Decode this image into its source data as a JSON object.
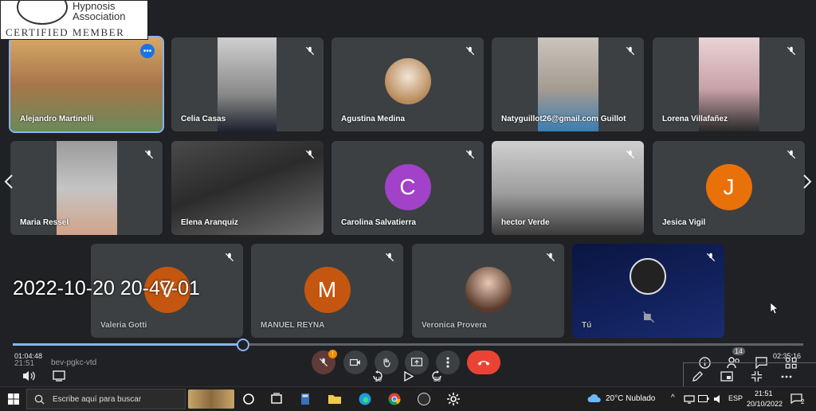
{
  "logo": {
    "assoc_text": "Hypnosis\nAssociation",
    "cert_text": "CERTIFIED MEMBER"
  },
  "participants": {
    "row1": [
      {
        "name": "Alejandro Martinelli"
      },
      {
        "name": "Celia Casas"
      },
      {
        "name": "Agustina Medina"
      },
      {
        "name": "Natyguillot26@gmail.com Guillot"
      },
      {
        "name": "Lorena Villafañez"
      }
    ],
    "row2": [
      {
        "name": "Maria Ressel"
      },
      {
        "name": "Elena Aranquiz"
      },
      {
        "name": "Carolina Salvatierra",
        "initial": "C",
        "color": "#a142c8"
      },
      {
        "name": "hector Verde"
      },
      {
        "name": "Jesica Vigil",
        "initial": "J",
        "color": "#e8710a"
      }
    ],
    "row3": [
      {
        "name": "Valeria Gotti",
        "initial": "V",
        "color": "#c5560f"
      },
      {
        "name": "MANUEL REYNA",
        "initial": "M",
        "color": "#c5560f"
      },
      {
        "name": "Veronica Provera"
      },
      {
        "name": "Tú"
      }
    ]
  },
  "recording": {
    "timestamp": "2022-10-20 20-47-01",
    "elapsed": "01:04:48",
    "total": "02:35:16",
    "progress_fraction": 0.29
  },
  "controls": {
    "clock": "21:51",
    "meeting_code": "bev-pgkc-vtd",
    "mic_badge": "!",
    "rewind_label": "10",
    "forward_label": "30",
    "participants_count": "14"
  },
  "taskbar": {
    "search_placeholder": "Escribe aquí para buscar",
    "weather": "20°C Nublado",
    "lang": "ESP",
    "time": "21:51",
    "date": "20/10/2022",
    "notif_count": "2"
  }
}
